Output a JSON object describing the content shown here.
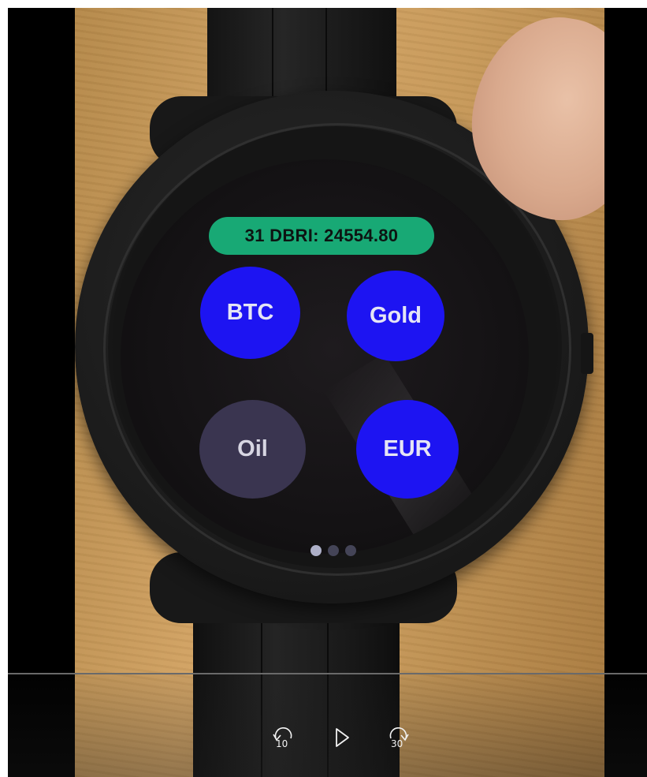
{
  "player": {
    "controls": {
      "rewind_seconds": "10",
      "forward_seconds": "30",
      "play_icon": "play-icon",
      "rewind_icon": "rewind-10-icon",
      "forward_icon": "forward-30-icon"
    }
  },
  "watch_screen": {
    "ticker": "31 DBRI: 24554.80",
    "buttons": [
      {
        "label": "BTC",
        "state": "active"
      },
      {
        "label": "Gold",
        "state": "active"
      },
      {
        "label": "Oil",
        "state": "inactive"
      },
      {
        "label": "EUR",
        "state": "active"
      }
    ],
    "page_indicator": {
      "pages": 3,
      "current": 1
    }
  },
  "colors": {
    "ticker_bg": "#18a975",
    "active_button": "#1d14f2",
    "inactive_button": "#3a3550"
  }
}
